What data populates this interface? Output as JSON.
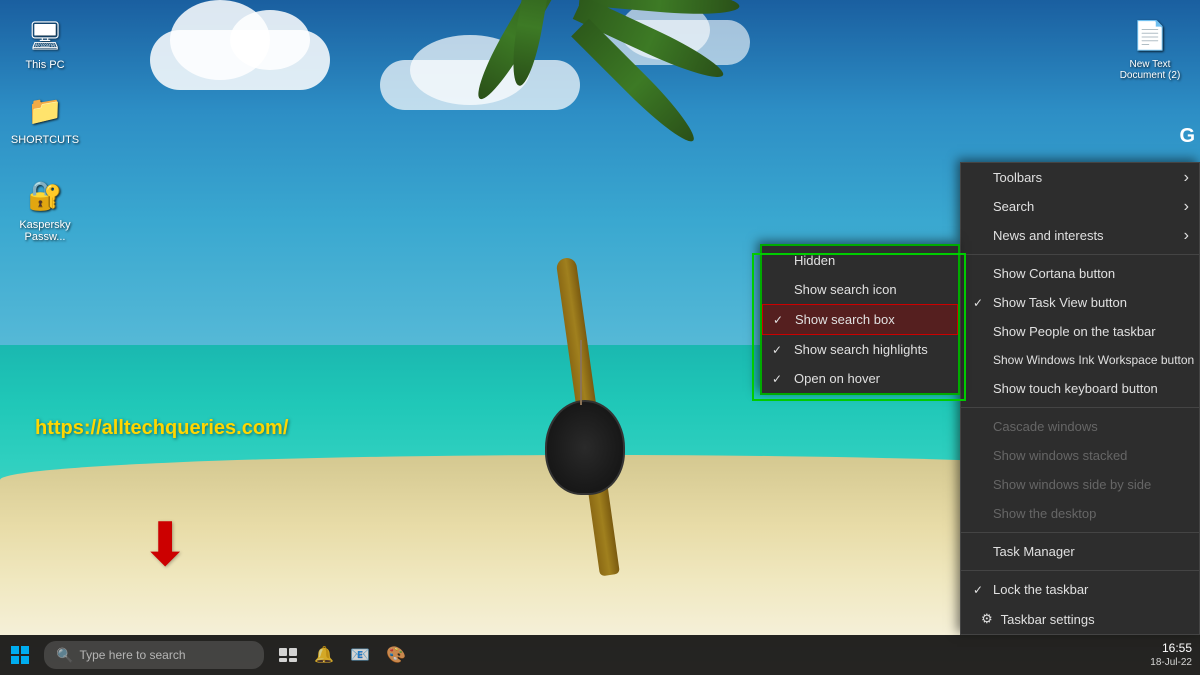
{
  "desktop": {
    "background_desc": "tropical beach with palm tree",
    "icons": [
      {
        "id": "this-pc",
        "label": "This PC",
        "symbol": "🖥"
      },
      {
        "id": "shortcuts",
        "label": "SHORTCUTS",
        "symbol": "📁"
      },
      {
        "id": "kaspersky",
        "label": "Kaspersky Passw...",
        "symbol": "🔐"
      },
      {
        "id": "new-text",
        "label": "New Text\nDocument (2)",
        "symbol": "📄"
      }
    ],
    "url_watermark": "https://alltechqueries.com/",
    "g_letter": "G"
  },
  "taskbar": {
    "search_placeholder": "Type here to search",
    "time": "16:55",
    "date": "18-Jul-22"
  },
  "context_menu_main": {
    "items": [
      {
        "id": "toolbars",
        "label": "Toolbars",
        "has_arrow": true,
        "checked": false,
        "disabled": false
      },
      {
        "id": "search",
        "label": "Search",
        "has_arrow": true,
        "checked": false,
        "disabled": false
      },
      {
        "id": "news-interests",
        "label": "News and interests",
        "has_arrow": true,
        "checked": false,
        "disabled": false
      },
      {
        "id": "show-cortana",
        "label": "Show Cortana button",
        "has_arrow": false,
        "checked": false,
        "disabled": false
      },
      {
        "id": "show-taskview",
        "label": "Show Task View button",
        "has_arrow": false,
        "checked": true,
        "disabled": false
      },
      {
        "id": "show-people",
        "label": "Show People on the taskbar",
        "has_arrow": false,
        "checked": false,
        "disabled": false
      },
      {
        "id": "show-ink",
        "label": "Show Windows Ink Workspace button",
        "has_arrow": false,
        "checked": false,
        "disabled": false
      },
      {
        "id": "show-touch-kb",
        "label": "Show touch keyboard button",
        "has_arrow": false,
        "checked": false,
        "disabled": false
      },
      {
        "id": "separator1",
        "type": "separator"
      },
      {
        "id": "cascade",
        "label": "Cascade windows",
        "has_arrow": false,
        "checked": false,
        "disabled": true
      },
      {
        "id": "stacked",
        "label": "Show windows stacked",
        "has_arrow": false,
        "checked": false,
        "disabled": true
      },
      {
        "id": "side-by-side",
        "label": "Show windows side by side",
        "has_arrow": false,
        "checked": false,
        "disabled": true
      },
      {
        "id": "show-desktop",
        "label": "Show the desktop",
        "has_arrow": false,
        "checked": false,
        "disabled": true
      },
      {
        "id": "separator2",
        "type": "separator"
      },
      {
        "id": "task-manager",
        "label": "Task Manager",
        "has_arrow": false,
        "checked": false,
        "disabled": false
      },
      {
        "id": "separator3",
        "type": "separator"
      },
      {
        "id": "lock-taskbar",
        "label": "Lock the taskbar",
        "has_arrow": false,
        "checked": true,
        "disabled": false
      },
      {
        "id": "taskbar-settings",
        "label": "Taskbar settings",
        "has_arrow": false,
        "checked": false,
        "disabled": false,
        "gear": true
      }
    ]
  },
  "context_menu_search": {
    "items": [
      {
        "id": "hidden",
        "label": "Hidden",
        "checked": false
      },
      {
        "id": "show-search-icon",
        "label": "Show search icon",
        "checked": false
      },
      {
        "id": "show-search-box",
        "label": "Show search box",
        "checked": true,
        "highlighted": true
      },
      {
        "id": "show-search-highlights",
        "label": "Show search highlights",
        "checked": true
      },
      {
        "id": "open-on-hover",
        "label": "Open on hover",
        "checked": true
      }
    ]
  }
}
